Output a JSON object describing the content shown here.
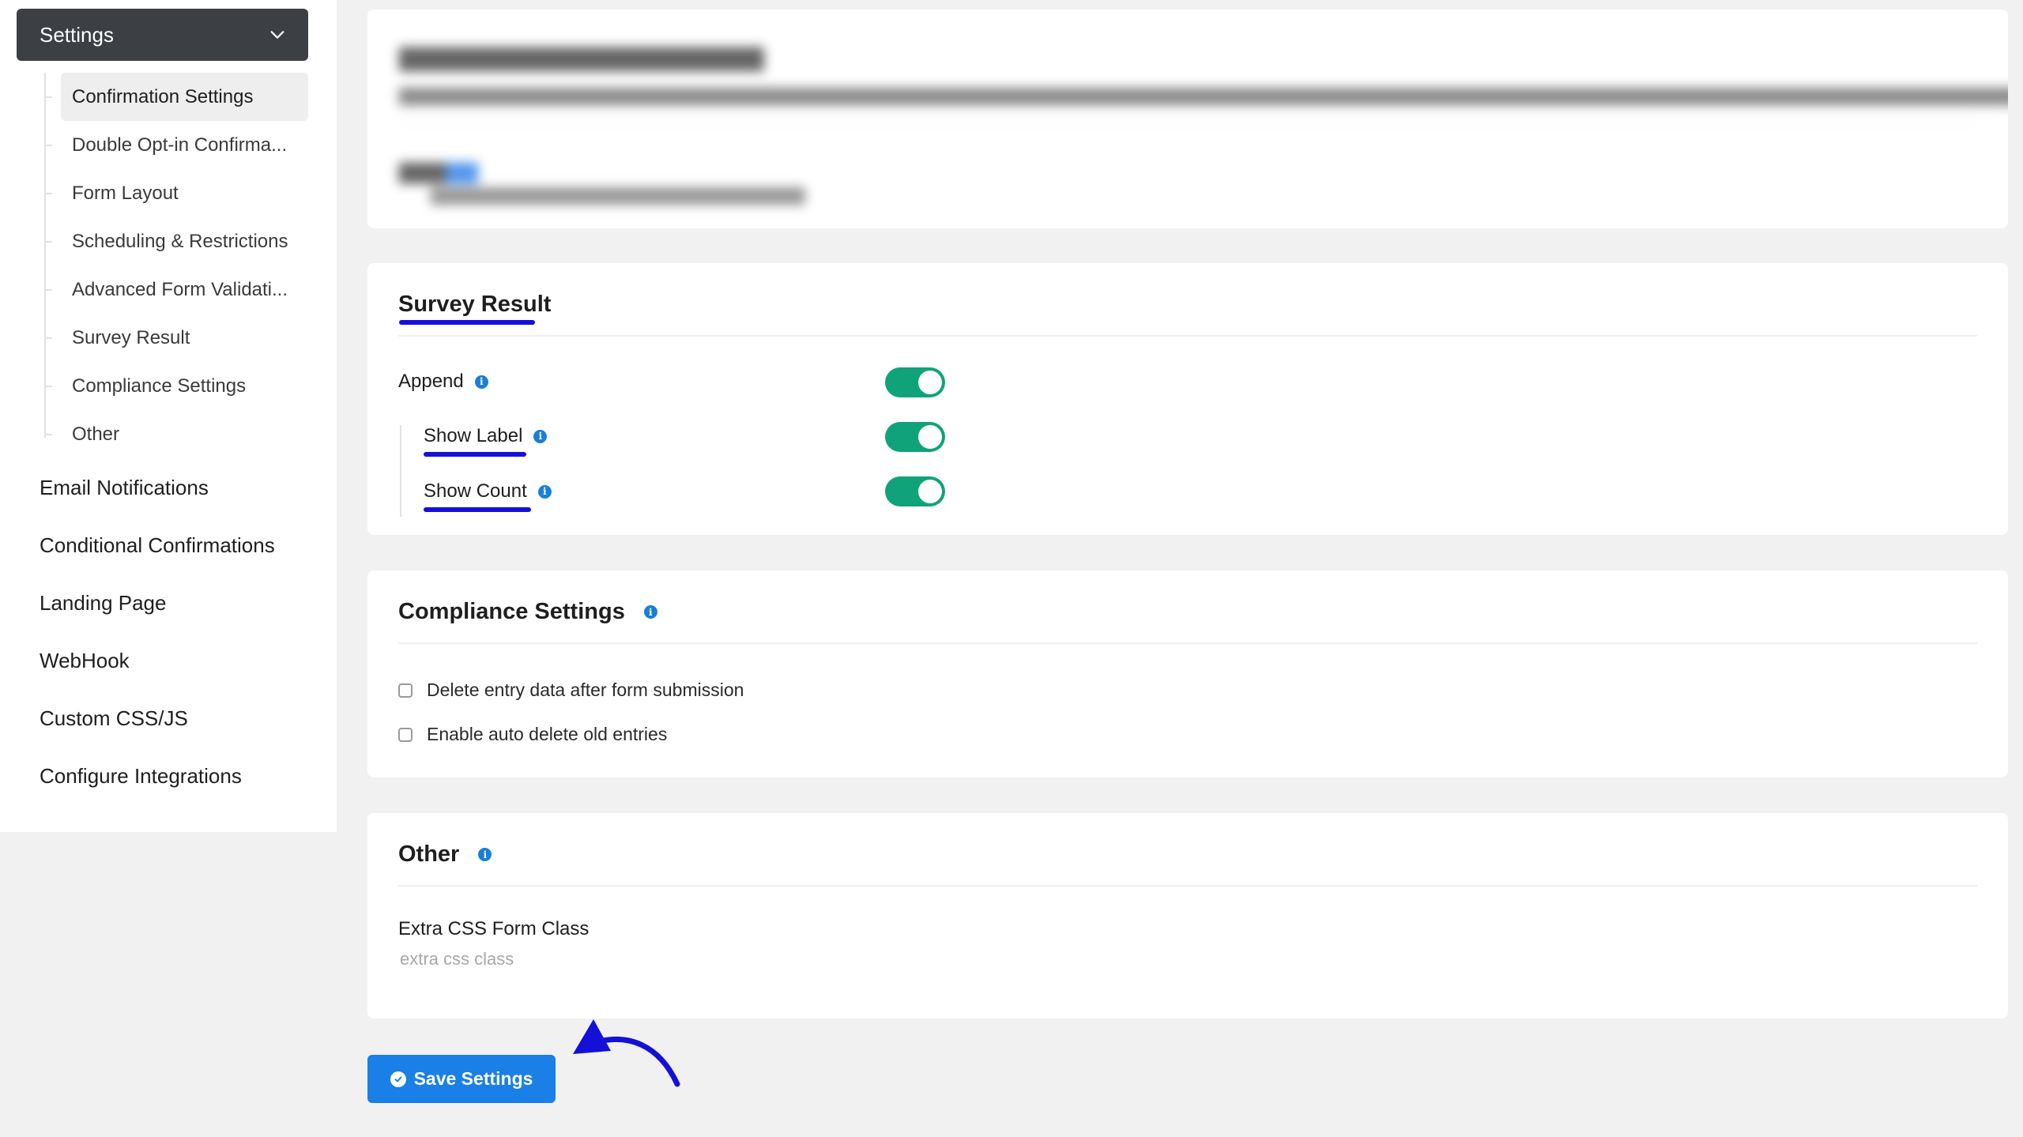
{
  "sidebar": {
    "header_label": "Settings",
    "sub_items": [
      {
        "label": "Confirmation Settings",
        "active": true
      },
      {
        "label": "Double Opt-in Confirma..."
      },
      {
        "label": "Form Layout"
      },
      {
        "label": "Scheduling & Restrictions"
      },
      {
        "label": "Advanced Form Validati..."
      },
      {
        "label": "Survey Result"
      },
      {
        "label": "Compliance Settings"
      },
      {
        "label": "Other"
      }
    ],
    "main_items": [
      {
        "label": "Email Notifications"
      },
      {
        "label": "Conditional Confirmations"
      },
      {
        "label": "Landing Page"
      },
      {
        "label": "WebHook"
      },
      {
        "label": "Custom CSS/JS"
      },
      {
        "label": "Configure Integrations"
      }
    ]
  },
  "survey_result": {
    "title": "Survey Result",
    "append_label": "Append",
    "append_on": true,
    "show_label_label": "Show Label",
    "show_label_on": true,
    "show_count_label": "Show Count",
    "show_count_on": true
  },
  "compliance": {
    "title": "Compliance Settings",
    "delete_entry_label": "Delete entry data after form submission",
    "delete_entry_checked": false,
    "auto_delete_label": "Enable auto delete old entries",
    "auto_delete_checked": false
  },
  "other": {
    "title": "Other",
    "extra_css_label": "Extra CSS Form Class",
    "extra_css_placeholder": "extra css class",
    "extra_css_value": ""
  },
  "save_button": {
    "label": "Save Settings"
  },
  "colors": {
    "toggle_on": "#10a37a",
    "primary": "#1a7fe6",
    "annotation": "#1410d8",
    "sidebar_header": "#3c4044"
  },
  "icons": [
    "chevron-down-icon",
    "info-icon",
    "check-circle-icon",
    "annotation-arrow"
  ]
}
